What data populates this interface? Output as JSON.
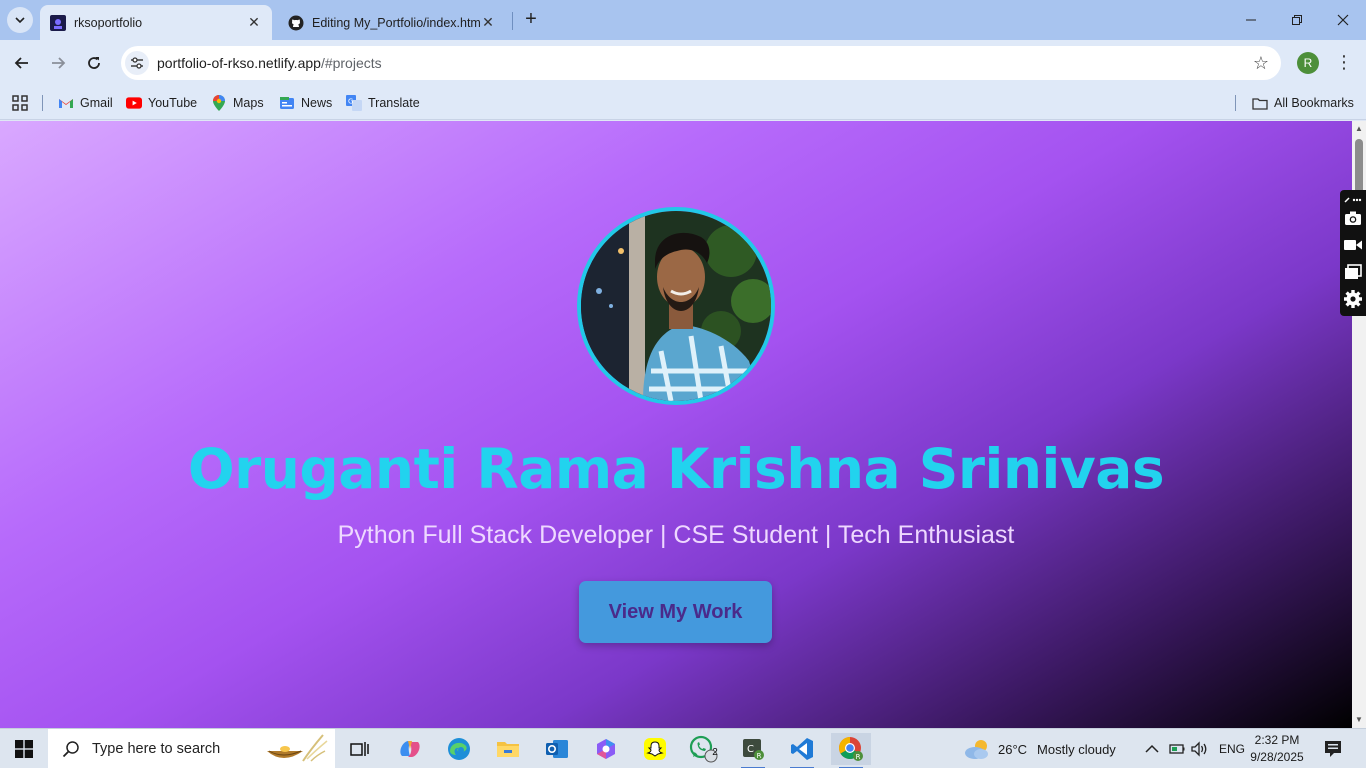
{
  "browser": {
    "tabs": [
      {
        "title": "rksoportfolio",
        "active": true
      },
      {
        "title": "Editing My_Portfolio/index.html",
        "active": false
      }
    ],
    "url_host": "portfolio-of-rkso.netlify.app",
    "url_path": "/#projects",
    "profile_initial": "R",
    "bookmarks": [
      {
        "label": "Gmail",
        "icon": "gmail-icon"
      },
      {
        "label": "YouTube",
        "icon": "youtube-icon"
      },
      {
        "label": "Maps",
        "icon": "maps-icon"
      },
      {
        "label": "News",
        "icon": "news-icon"
      },
      {
        "label": "Translate",
        "icon": "translate-icon"
      }
    ],
    "all_bookmarks_label": "All Bookmarks"
  },
  "hero": {
    "name": "Oruganti Rama Krishna Srinivas",
    "subtitle": "Python Full Stack Developer | CSE Student | Tech Enthusiast",
    "cta_label": "View My Work",
    "colors": {
      "name": "#22d3ee",
      "button": "#4499dd",
      "ring": "#22c9e8"
    }
  },
  "taskbar": {
    "search_placeholder": "Type here to search",
    "whatsapp_badge": "2",
    "weather_temp": "26°C",
    "weather_desc": "Mostly cloudy",
    "language": "ENG",
    "time": "2:32 PM",
    "date": "9/28/2025"
  }
}
